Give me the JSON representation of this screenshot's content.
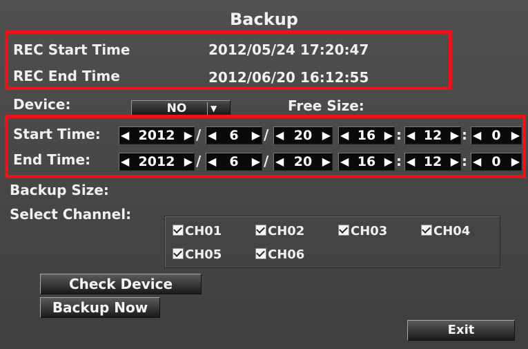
{
  "title": "Backup",
  "rec": {
    "start_label": "REC Start Time",
    "start_value": "2012/05/24 17:20:47",
    "end_label": "REC End Time",
    "end_value": "2012/06/20 16:12:55"
  },
  "device": {
    "label": "Device:",
    "value": "NO",
    "free_size_label": "Free Size:"
  },
  "start_time": {
    "label": "Start Time:",
    "year": "2012",
    "month": "6",
    "day": "20",
    "hour": "16",
    "minute": "12",
    "second": "0"
  },
  "end_time": {
    "label": "End Time:",
    "year": "2012",
    "month": "6",
    "day": "20",
    "hour": "16",
    "minute": "12",
    "second": "0"
  },
  "separators": {
    "date": "/",
    "time": ":"
  },
  "backup_size_label": "Backup Size:",
  "select_channel_label": "Select Channel:",
  "channels": [
    {
      "label": "CH01",
      "checked": true
    },
    {
      "label": "CH02",
      "checked": true
    },
    {
      "label": "CH03",
      "checked": true
    },
    {
      "label": "CH04",
      "checked": true
    },
    {
      "label": "CH05",
      "checked": true
    },
    {
      "label": "CH06",
      "checked": true
    }
  ],
  "buttons": {
    "check_device": "Check Device",
    "backup_now": "Backup Now",
    "exit": "Exit"
  },
  "colors": {
    "highlight": "#e8141b",
    "background": "#4a4a4a",
    "spinner": "#0a0a0a"
  }
}
